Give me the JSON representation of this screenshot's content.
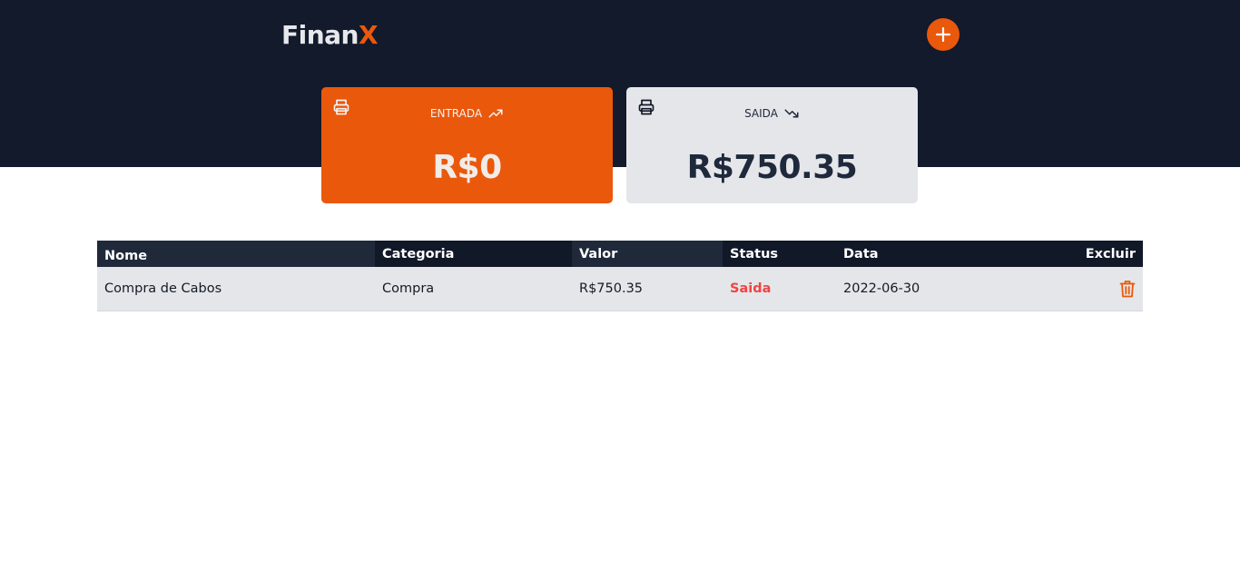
{
  "header": {
    "logo_main": "Finan",
    "logo_accent": "X",
    "add_icon": "plus-icon"
  },
  "cards": {
    "entrada": {
      "label": "ENTRADA",
      "amount": "R$0",
      "icon": "printer-icon",
      "trend_icon": "trending-up-icon"
    },
    "saida": {
      "label": "SAIDA",
      "amount": "R$750.35",
      "icon": "printer-icon",
      "trend_icon": "trending-down-icon"
    }
  },
  "table": {
    "columns": [
      "Nome",
      "Categoria",
      "Valor",
      "Status",
      "Data",
      "Excluir"
    ],
    "rows": [
      {
        "nome": "Compra de Cabos",
        "categoria": "Compra",
        "valor": "R$750.35",
        "status": "Saida",
        "data": "2022-06-30",
        "delete_icon": "trash-icon"
      }
    ]
  },
  "colors": {
    "header_bg": "#121a2c",
    "accent": "#ea580c",
    "card_out_bg": "#e5e6ea",
    "status_saida": "#ef4444"
  }
}
